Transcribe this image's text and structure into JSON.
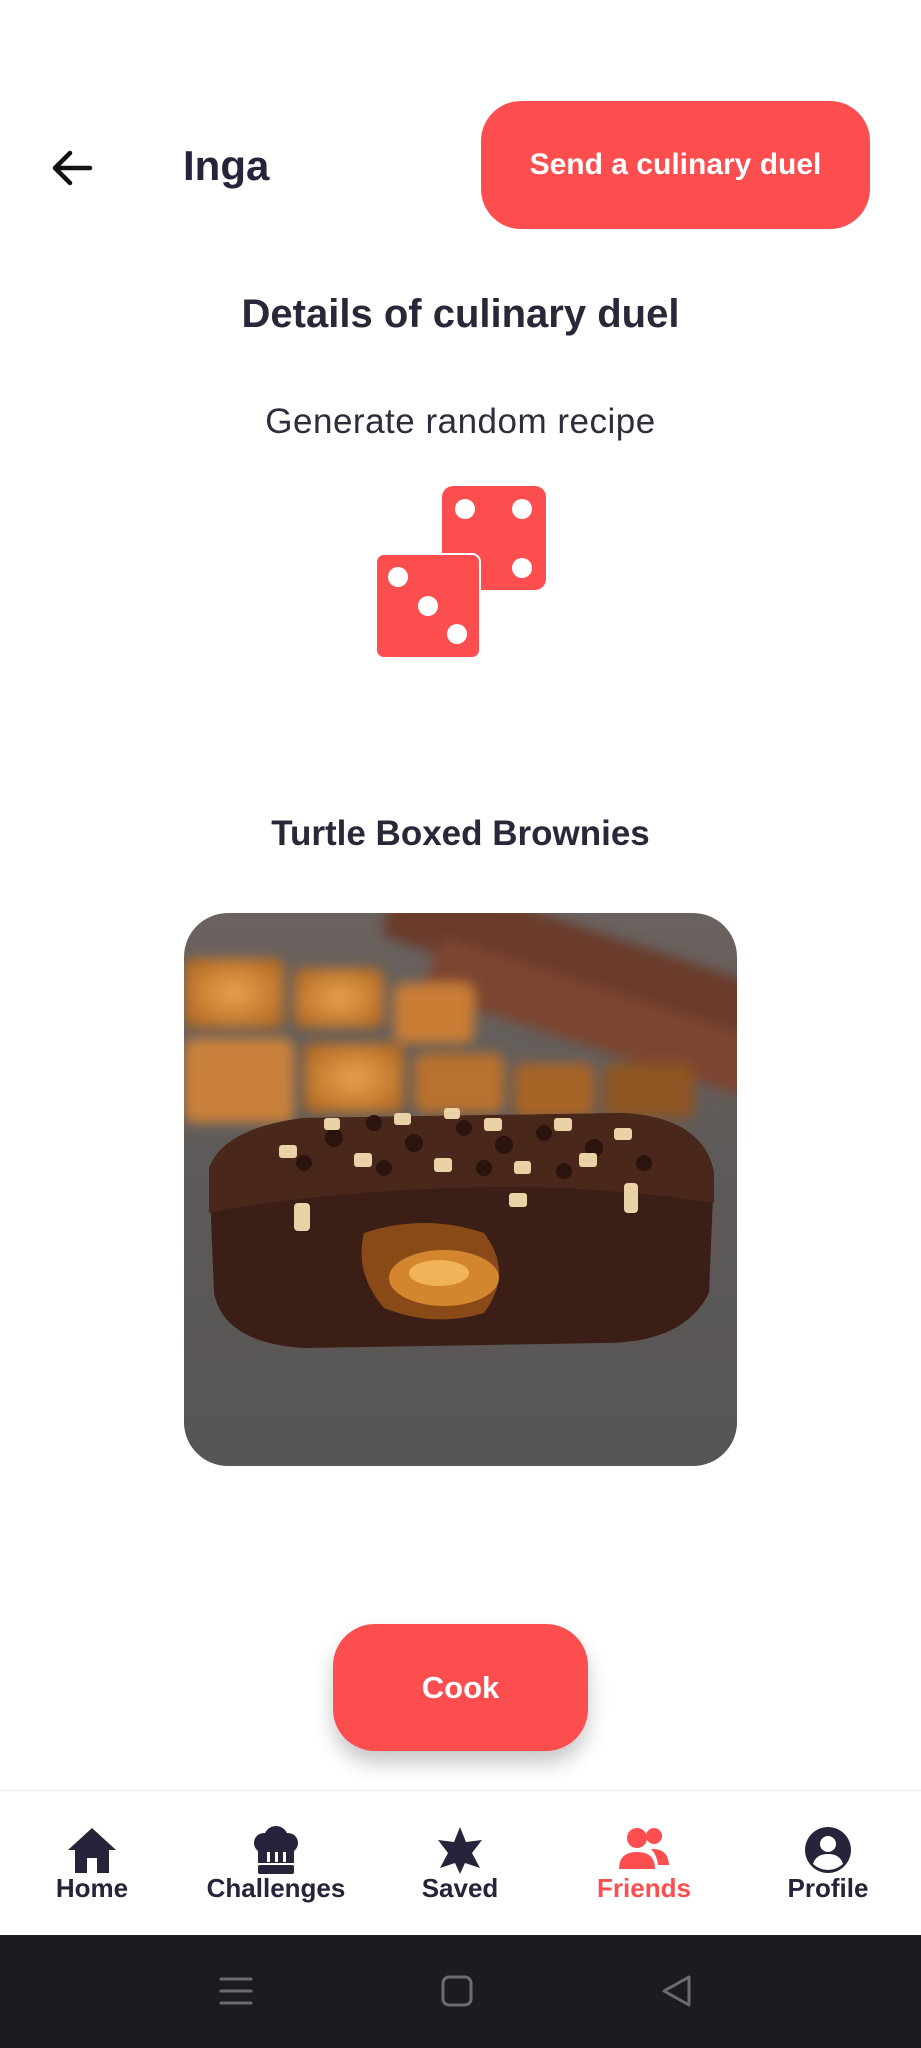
{
  "header": {
    "back_icon": "arrow-left-icon",
    "friend_name": "Inga",
    "send_duel_label": "Send a culinary duel"
  },
  "duel": {
    "section_title": "Details of culinary duel",
    "generate_label": "Generate random recipe",
    "dice_icon": "dice-icon"
  },
  "recipe": {
    "title": "Turtle Boxed Brownies",
    "image_alt": "brownie photo"
  },
  "cook_label": "Cook",
  "tabs": [
    {
      "label": "Home",
      "icon": "home-icon",
      "active": false
    },
    {
      "label": "Challenges",
      "icon": "chef-hat-icon",
      "active": false
    },
    {
      "label": "Saved",
      "icon": "star-icon",
      "active": false
    },
    {
      "label": "Friends",
      "icon": "friends-icon",
      "active": true
    },
    {
      "label": "Profile",
      "icon": "profile-icon",
      "active": false
    }
  ],
  "colors": {
    "accent": "#fc4d4f",
    "text_dark": "#26243a",
    "system_bar": "#1c1b20"
  },
  "system_nav": [
    "menu-icon",
    "home-square-icon",
    "back-triangle-icon"
  ]
}
